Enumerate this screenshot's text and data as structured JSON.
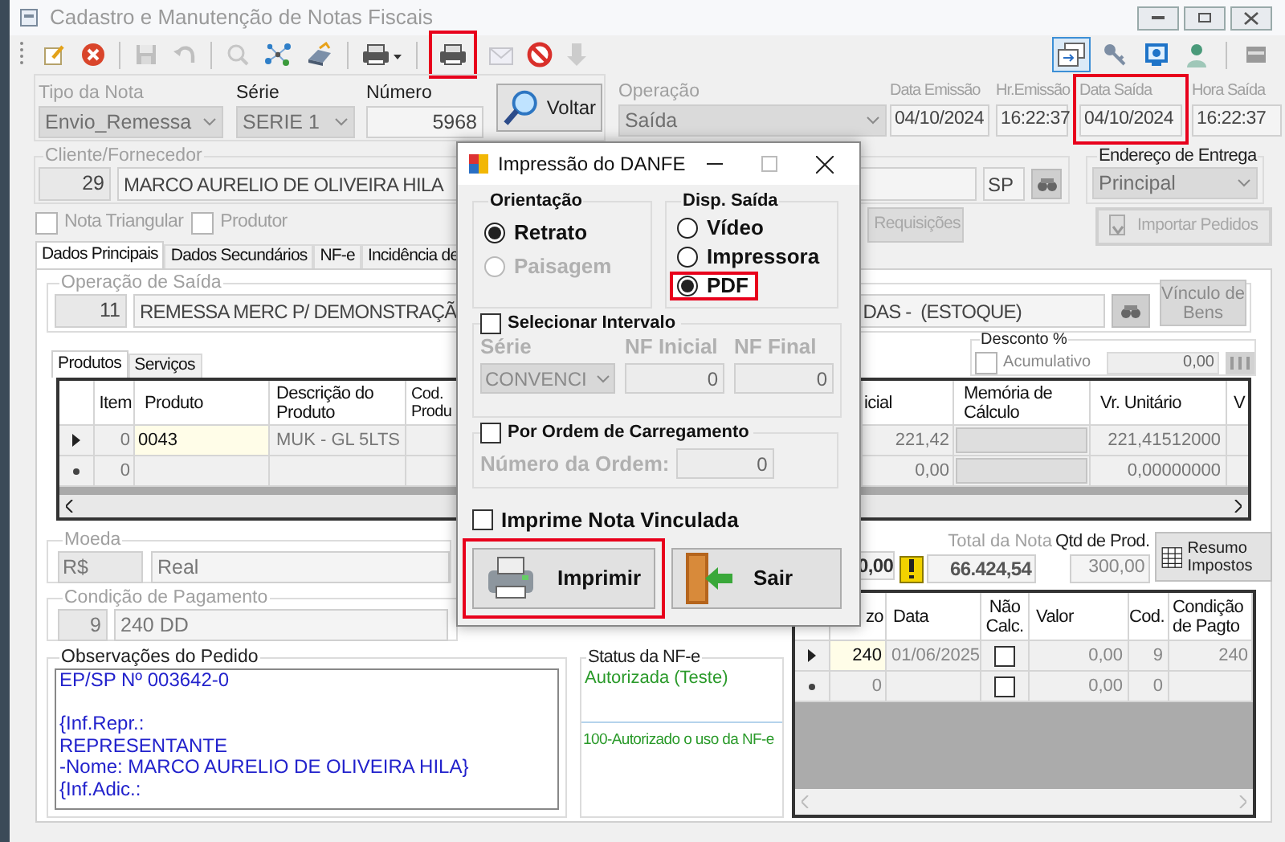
{
  "window": {
    "title": "Cadastro e Manutenção de Notas Fiscais"
  },
  "toolbar": {
    "groups": [
      [
        {
          "kind": "new",
          "disabled": false,
          "highlighted": false
        },
        {
          "kind": "cancel",
          "disabled": false,
          "highlighted": false
        }
      ],
      [
        {
          "kind": "save",
          "disabled": true,
          "highlighted": false
        },
        {
          "kind": "undo",
          "disabled": true,
          "highlighted": false
        }
      ],
      [
        {
          "kind": "search",
          "disabled": true,
          "highlighted": false
        },
        {
          "kind": "network",
          "disabled": false,
          "highlighted": false
        },
        {
          "kind": "scanner",
          "disabled": false,
          "highlighted": false
        }
      ],
      [
        {
          "kind": "print_menu",
          "disabled": false,
          "highlighted": false
        }
      ],
      [
        {
          "kind": "print",
          "disabled": false,
          "highlighted": true
        },
        {
          "kind": "email",
          "disabled": true,
          "highlighted": false
        },
        {
          "kind": "stop",
          "disabled": false,
          "highlighted": false
        },
        {
          "kind": "download",
          "disabled": true,
          "highlighted": false
        }
      ]
    ]
  },
  "right_toolbar": [
    {
      "kind": "window",
      "pressed": true
    },
    {
      "kind": "key",
      "pressed": false
    },
    {
      "kind": "monitor",
      "pressed": false
    },
    {
      "kind": "person",
      "pressed": false
    },
    {
      "kind": "panel",
      "pressed": false
    }
  ],
  "tipo_nota": {
    "label": "Tipo da Nota",
    "value": "Envio_Remessa"
  },
  "serie": {
    "label": "Série",
    "value": "SERIE 1"
  },
  "numero": {
    "label": "Número",
    "value": "5968"
  },
  "voltar_button": "Voltar",
  "operacao": {
    "label": "Operação",
    "value": "Saída"
  },
  "dates": [
    {
      "label": "Data Emissão",
      "value": "04/10/2024",
      "highlighted": false
    },
    {
      "label": "Hr.Emissão",
      "value": "16:22:37",
      "highlighted": false
    },
    {
      "label": "Data Saída",
      "value": "04/10/2024",
      "highlighted": true
    },
    {
      "label": "Hora Saída",
      "value": "16:22:37",
      "highlighted": false
    }
  ],
  "cliente": {
    "label": "Cliente/Fornecedor",
    "code": "29",
    "name": "MARCO AURELIO DE OLIVEIRA HILA",
    "uf": "SP"
  },
  "endereco_entrega": {
    "label": "Endereço de Entrega",
    "value": "Principal"
  },
  "options": [
    {
      "label": "Nota Triangular",
      "checked": false
    },
    {
      "label": "Produtor",
      "checked": false
    }
  ],
  "requisicoes_button": "Requisições",
  "importar_button": "Importar Pedidos",
  "tabs": [
    {
      "label": "Dados Principais",
      "selected": true
    },
    {
      "label": "Dados Secundários",
      "selected": false
    },
    {
      "label": "NF-e",
      "selected": false
    },
    {
      "label": "Incidência de",
      "selected": false
    }
  ],
  "operacao_saida": {
    "label": "Operação de Saída",
    "code": "11",
    "value_left": "REMESSA MERC P/ DEMONSTRAÇÃ",
    "value_right": "DAS -  (ESTOQUE)"
  },
  "vinculo_button": "Vínculo de Bens",
  "sub_tabs": [
    {
      "label": "Produtos",
      "selected": true
    },
    {
      "label": "Serviços",
      "selected": false
    }
  ],
  "desconto": {
    "label": "Desconto %",
    "checkbox_label": "Acumulativo",
    "checked": false,
    "value": "0,00"
  },
  "products_table": {
    "columns": [
      "Item",
      "Produto",
      "Descrição do Produto",
      "Cod. Produ",
      "icial",
      "Memória de Cálculo",
      "Vr. Unitário",
      "V"
    ],
    "rows": [
      {
        "kind": "current",
        "item": "0",
        "produto": "0043",
        "descricao": "MUK - GL 5LTS",
        "inicial": "221,42",
        "vr_unitario": "221,41512000"
      },
      {
        "kind": "new",
        "item": "0",
        "inicial": "0,00",
        "vr_unitario": "0,00000000"
      }
    ]
  },
  "moeda": {
    "label": "Moeda",
    "code": "R$",
    "name": "Real"
  },
  "totals": {
    "partial_value": "0,00",
    "total_label": "Total da Nota",
    "total": "66.424,54",
    "qtd_label": "Qtd de Prod.",
    "qtd": "300,00"
  },
  "resumo_button": "Resumo Impostos",
  "condicao": {
    "label": "Condição de Pagamento",
    "code": "9",
    "name": "240 DD"
  },
  "observacoes": {
    "label": "Observações do Pedido",
    "text": "EP/SP Nº 003642-0\n\n{Inf.Repr.:\nREPRESENTANTE\n-Nome: MARCO AURELIO DE OLIVEIRA HILA}\n{Inf.Adic.:"
  },
  "status_nfe": {
    "label": "Status da NF-e",
    "status": "Autorizada (Teste)",
    "message": "100-Autorizado o uso da NF-e"
  },
  "parcelas_table": {
    "columns": [
      "zo",
      "Data",
      "Não Calc.",
      "Valor",
      "Cod.",
      "Condição de Pagto"
    ],
    "rows": [
      {
        "kind": "current",
        "prazo": "240",
        "data": "01/06/2025",
        "nao_calc": false,
        "valor": "0,00",
        "cod": "9",
        "condicao": "240"
      },
      {
        "kind": "new",
        "prazo": "0",
        "nao_calc": false,
        "valor": "0,00",
        "cod": "0"
      }
    ]
  },
  "dialog": {
    "title": "Impressão do DANFE",
    "orientacao": {
      "label": "Orientação",
      "options": [
        {
          "label": "Retrato",
          "selected": true,
          "disabled": false
        },
        {
          "label": "Paisagem",
          "selected": false,
          "disabled": true
        }
      ]
    },
    "saida": {
      "label": "Disp. Saída",
      "options": [
        {
          "label": "Vídeo",
          "selected": false,
          "highlighted": false
        },
        {
          "label": "Impressora",
          "selected": false,
          "highlighted": false
        },
        {
          "label": "PDF",
          "selected": true,
          "highlighted": true
        }
      ]
    },
    "intervalo": {
      "label": "Selecionar Intervalo",
      "checked": false,
      "serie_label": "Série",
      "serie": "CONVENCI",
      "inicial_label": "NF Inicial",
      "inicial": "0",
      "final_label": "NF Final",
      "final": "0"
    },
    "ordem": {
      "label": "Por Ordem de Carregamento",
      "checked": false,
      "numero_label": "Número da Ordem:",
      "numero": "0"
    },
    "vinculada": {
      "label": "Imprime Nota Vinculada",
      "checked": false
    },
    "buttons": [
      {
        "kind": "print",
        "label": "Imprimir",
        "highlighted": true
      },
      {
        "kind": "exit",
        "label": "Sair",
        "highlighted": false
      }
    ]
  }
}
